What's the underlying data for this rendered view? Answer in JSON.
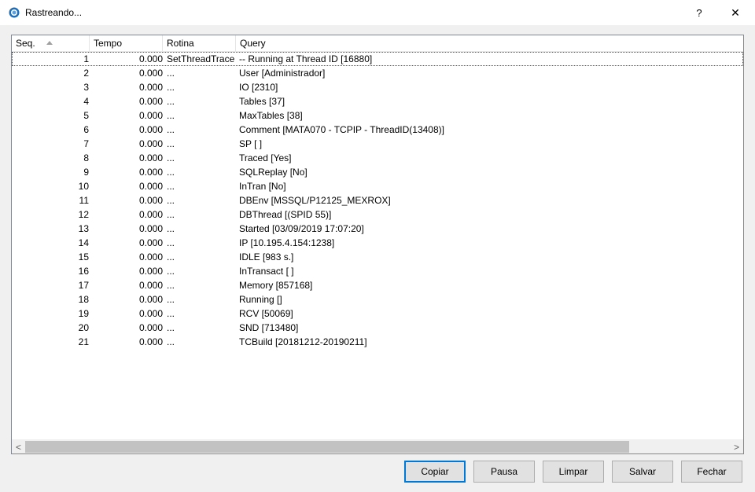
{
  "window": {
    "title": "Rastreando...",
    "help_label": "?",
    "close_label": "✕"
  },
  "columns": {
    "seq": "Seq.",
    "tempo": "Tempo",
    "rotina": "Rotina",
    "query": "Query"
  },
  "rows": [
    {
      "seq": "1",
      "tempo": "0.000",
      "rotina": "SetThreadTrace",
      "query": "-- Running at Thread ID [16880]"
    },
    {
      "seq": "2",
      "tempo": "0.000",
      "rotina": "...",
      "query": "User [Administrador]"
    },
    {
      "seq": "3",
      "tempo": "0.000",
      "rotina": "...",
      "query": "IO [2310]"
    },
    {
      "seq": "4",
      "tempo": "0.000",
      "rotina": "...",
      "query": "Tables [37]"
    },
    {
      "seq": "5",
      "tempo": "0.000",
      "rotina": "...",
      "query": "MaxTables [38]"
    },
    {
      "seq": "6",
      "tempo": "0.000",
      "rotina": "...",
      "query": "Comment [MATA070 - TCPIP - ThreadID(13408)]"
    },
    {
      "seq": "7",
      "tempo": "0.000",
      "rotina": "...",
      "query": "SP [ ]"
    },
    {
      "seq": "8",
      "tempo": "0.000",
      "rotina": "...",
      "query": "Traced [Yes]"
    },
    {
      "seq": "9",
      "tempo": "0.000",
      "rotina": "...",
      "query": "SQLReplay [No]"
    },
    {
      "seq": "10",
      "tempo": "0.000",
      "rotina": "...",
      "query": "InTran [No]"
    },
    {
      "seq": "11",
      "tempo": "0.000",
      "rotina": "...",
      "query": "DBEnv [MSSQL/P12125_MEXROX]"
    },
    {
      "seq": "12",
      "tempo": "0.000",
      "rotina": "...",
      "query": "DBThread [(SPID 55)]"
    },
    {
      "seq": "13",
      "tempo": "0.000",
      "rotina": "...",
      "query": "Started [03/09/2019 17:07:20]"
    },
    {
      "seq": "14",
      "tempo": "0.000",
      "rotina": "...",
      "query": "IP [10.195.4.154:1238]"
    },
    {
      "seq": "15",
      "tempo": "0.000",
      "rotina": "...",
      "query": "IDLE [983 s.]"
    },
    {
      "seq": "16",
      "tempo": "0.000",
      "rotina": "...",
      "query": "InTransact [ ]"
    },
    {
      "seq": "17",
      "tempo": "0.000",
      "rotina": "...",
      "query": "Memory [857168]"
    },
    {
      "seq": "18",
      "tempo": "0.000",
      "rotina": "...",
      "query": "Running []"
    },
    {
      "seq": "19",
      "tempo": "0.000",
      "rotina": "...",
      "query": "RCV [50069]"
    },
    {
      "seq": "20",
      "tempo": "0.000",
      "rotina": "...",
      "query": "SND [713480]"
    },
    {
      "seq": "21",
      "tempo": "0.000",
      "rotina": "...",
      "query": "TCBuild [20181212-20190211]"
    }
  ],
  "scrollbar": {
    "left_arrow": "<",
    "right_arrow": ">"
  },
  "buttons": {
    "copiar": "Copiar",
    "pausa": "Pausa",
    "limpar": "Limpar",
    "salvar": "Salvar",
    "fechar": "Fechar"
  },
  "colors": {
    "accent": "#0078d7",
    "app_icon": "#1e6fb8"
  }
}
